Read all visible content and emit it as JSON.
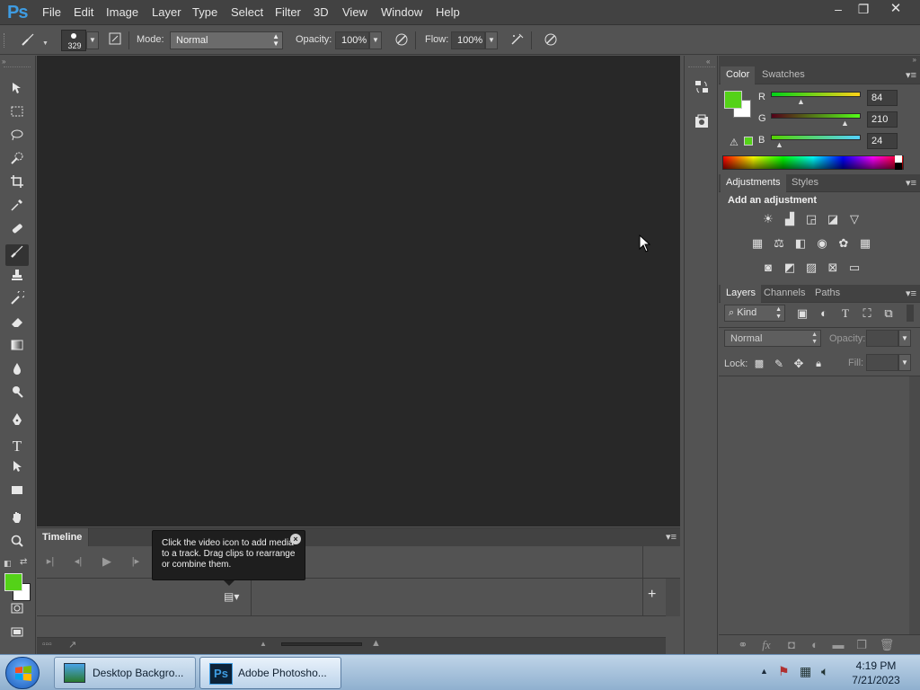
{
  "app": {
    "logo": "Ps"
  },
  "menu": [
    "File",
    "Edit",
    "Image",
    "Layer",
    "Type",
    "Select",
    "Filter",
    "3D",
    "View",
    "Window",
    "Help"
  ],
  "window_controls": {
    "minimize": "–",
    "restore": "❐",
    "close": "✕"
  },
  "options": {
    "brush_size": "329",
    "mode_label": "Mode:",
    "mode_value": "Normal",
    "opacity_label": "Opacity:",
    "opacity_value": "100%",
    "flow_label": "Flow:",
    "flow_value": "100%"
  },
  "tools": [
    "move-tool",
    "marquee-tool",
    "lasso-tool",
    "quick-selection-tool",
    "crop-tool",
    "eyedropper-tool",
    "healing-brush-tool",
    "brush-tool",
    "clone-stamp-tool",
    "history-brush-tool",
    "eraser-tool",
    "gradient-tool",
    "blur-tool",
    "dodge-tool",
    "pen-tool",
    "type-tool",
    "path-selection-tool",
    "rectangle-tool",
    "hand-tool",
    "zoom-tool"
  ],
  "colors": {
    "foreground": "#54d218",
    "background": "#ffffff",
    "canvas": "#282828"
  },
  "timeline": {
    "tab": "Timeline",
    "tooltip": "Click the video icon to add media to a track. Drag clips to rearrange or combine them.",
    "add_label": "+"
  },
  "color_panel": {
    "tabs": [
      "Color",
      "Swatches"
    ],
    "r_label": "R",
    "r_value": "84",
    "r_fraction": 0.33,
    "g_label": "G",
    "g_value": "210",
    "g_fraction": 0.82,
    "b_label": "B",
    "b_value": "24",
    "b_fraction": 0.09
  },
  "adjustments_panel": {
    "tabs": [
      "Adjustments",
      "Styles"
    ],
    "heading": "Add an adjustment"
  },
  "layers_panel": {
    "tabs": [
      "Layers",
      "Channels",
      "Paths"
    ],
    "kind_label": "Kind",
    "blend_mode": "Normal",
    "opacity_label": "Opacity:",
    "lock_label": "Lock:",
    "fill_label": "Fill:"
  },
  "taskbar": {
    "items": [
      "Desktop Backgro...",
      "Adobe Photosho..."
    ],
    "time": "4:19 PM",
    "date": "7/21/2023"
  }
}
